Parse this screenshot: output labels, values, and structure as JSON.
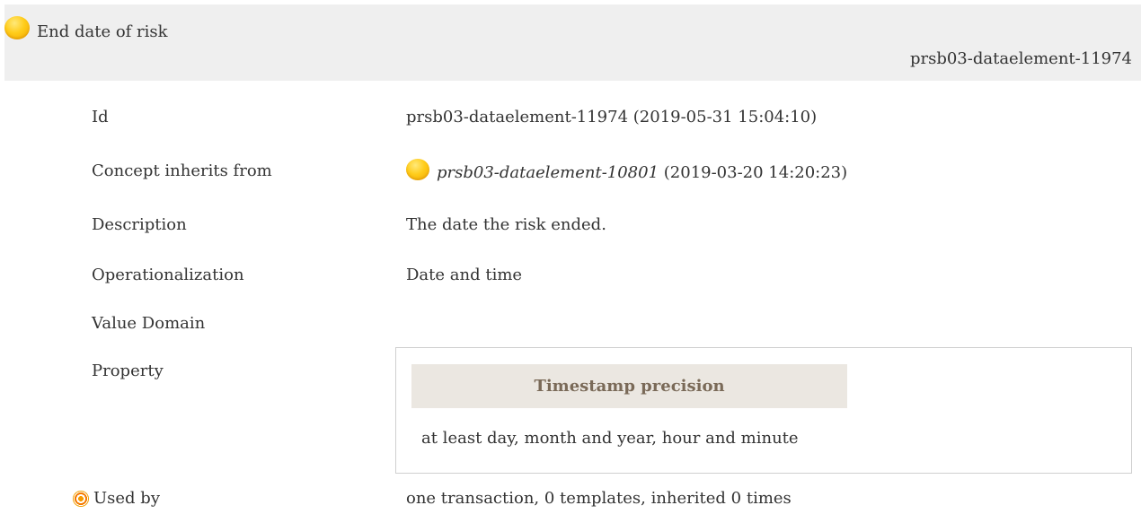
{
  "header": {
    "title": "End date of risk",
    "id": "prsb03-dataelement-11974",
    "status_icon": "yellow-orb-icon"
  },
  "rows": {
    "id": {
      "label": "Id",
      "value": "prsb03-dataelement-11974 (2019-05-31 15:04:10)"
    },
    "inherits": {
      "label": "Concept inherits from",
      "link": "prsb03-dataelement-10801",
      "suffix": " (2019-03-20 14:20:23)"
    },
    "description": {
      "label": "Description",
      "value": "The date the risk ended."
    },
    "operationalization": {
      "label": "Operationalization",
      "value": "Date and time"
    },
    "value_domain": {
      "label": "Value Domain"
    },
    "property": {
      "label": "Property",
      "head": "Timestamp precision",
      "value": "at least day, month and year, hour and minute"
    },
    "used_by": {
      "label": "Used by",
      "value": "one transaction, 0 templates, inherited 0 times",
      "icon": "target-icon"
    }
  },
  "colors": {
    "header_bg": "#efefef",
    "property_head_bg": "#ebe7e1",
    "property_head_text": "#7a6a58"
  }
}
